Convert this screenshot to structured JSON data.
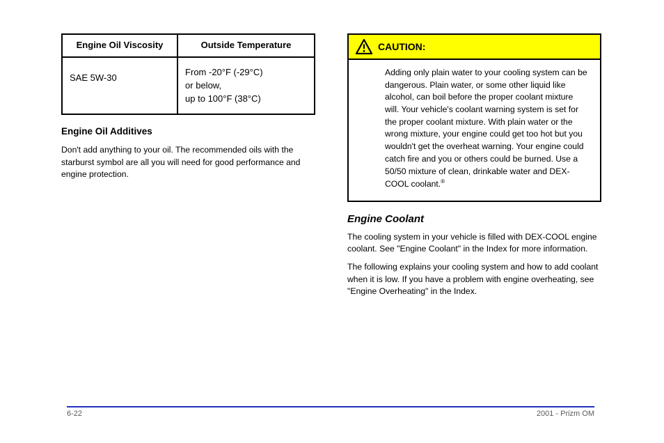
{
  "leftColumn": {
    "table": {
      "header": {
        "viscosity": "Engine Oil Viscosity",
        "temp": "Outside Temperature"
      },
      "row": {
        "viscosity": "SAE 5W-30",
        "line1": "From -20°F (-29°C)",
        "line2": "or below,",
        "line3": "up to 100°F (38°C)"
      }
    },
    "heading": "Engine Oil Additives",
    "paragraph": "Don't add anything to your oil. The recommended oils with the starburst symbol are all you will need for good performance and engine protection."
  },
  "rightColumn": {
    "coolantHeading": "Engine Coolant",
    "coolantPara": "The cooling system in your vehicle is filled with DEX-COOL engine coolant. See \"Engine Coolant\" in the Index for more information.",
    "coolantPara2": "The following explains your cooling system and how to add coolant when it is low. If you have a problem with engine overheating, see \"Engine Overheating\" in the Index.",
    "caution": {
      "title": "CAUTION:",
      "body": "Adding only plain water to your cooling system can be dangerous. Plain water, or some other liquid like alcohol, can boil before the proper coolant mixture will. Your vehicle's coolant warning system is set for the proper coolant mixture. With plain water or the wrong mixture, your engine could get too hot but you wouldn't get the overheat warning. Your engine could catch fire and you or others could be burned. Use a 50/50 mixture of clean, drinkable water and DEX-COOL coolant."
    },
    "registered": "®"
  },
  "footer": {
    "pdfLabel": "2001 - Prizm OM",
    "pageNum": "6-22"
  }
}
